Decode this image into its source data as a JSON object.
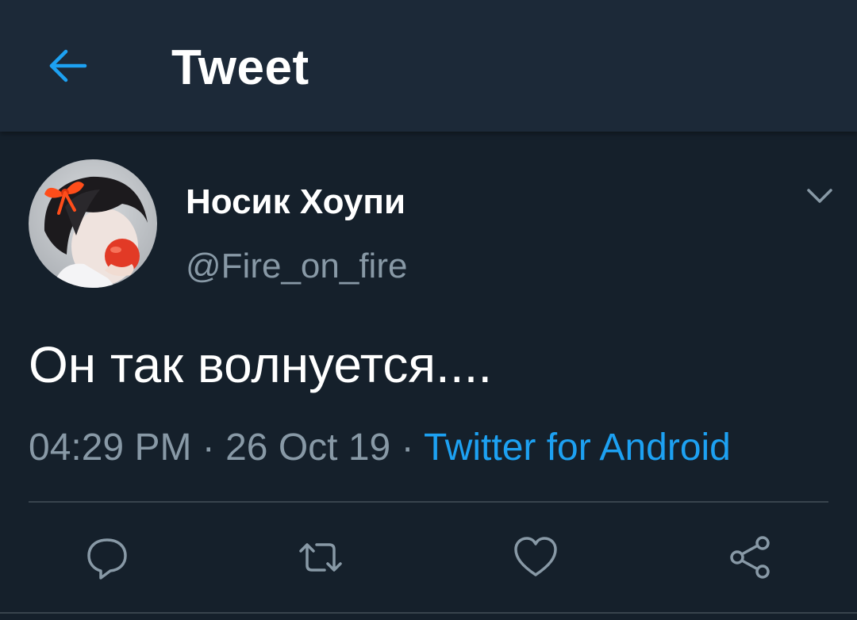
{
  "header": {
    "title": "Tweet",
    "back_icon": "arrow-left-icon"
  },
  "tweet": {
    "author": {
      "display_name": "Носик Хоупи",
      "handle": "@Fire_on_fire",
      "avatar": "user-avatar-image"
    },
    "text": "Он так волнуется....",
    "time": "04:29 PM",
    "separator": " · ",
    "date": "26 Oct 19",
    "source": "Twitter for Android"
  },
  "actions": [
    {
      "name": "reply",
      "icon": "reply-bubble-icon"
    },
    {
      "name": "retweet",
      "icon": "retweet-icon"
    },
    {
      "name": "like",
      "icon": "heart-icon"
    },
    {
      "name": "share",
      "icon": "share-icon"
    }
  ],
  "colors": {
    "background": "#15202b",
    "header_background": "#1c2938",
    "accent": "#1da1f2",
    "secondary_text": "#8899a6",
    "divider": "#38444d"
  }
}
